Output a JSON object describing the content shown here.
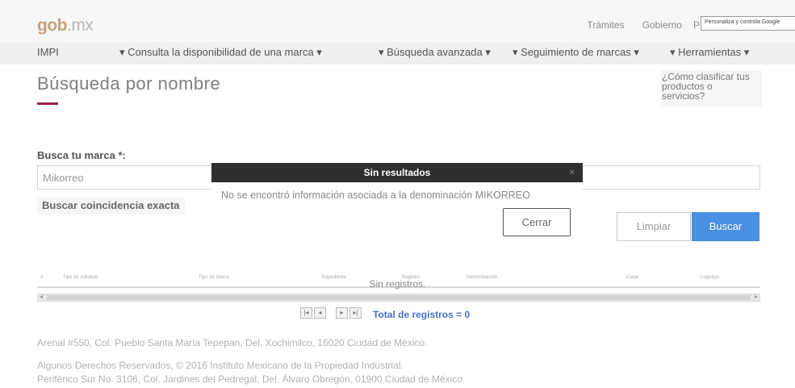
{
  "header": {
    "logo_main": "gob",
    "logo_suffix": ".mx",
    "links": [
      "Trámites",
      "Gobierno"
    ],
    "partial_link": "P",
    "tooltip": "Personaliza y controla Google"
  },
  "nav": {
    "home": "IMPI",
    "items": [
      "Consulta la disponibilidad de una marca",
      "Búsqueda avanzada",
      "Seguimiento de marcas",
      "Herramientas"
    ]
  },
  "page": {
    "title": "Búsqueda por nombre",
    "side_link": "¿Cómo clasificar tus productos o servicios?"
  },
  "form": {
    "label": "Busca tu marca",
    "required_mark": "*:",
    "value": "Mikorreo",
    "exact_match_label": "Buscar coincidencia exacta",
    "clear_label": "Limpiar",
    "search_label": "Buscar"
  },
  "modal": {
    "title": "Sin resultados",
    "close_icon": "×",
    "message": "No se encontró información asociada a la denominación MIKORREO",
    "close_label": "Cerrar"
  },
  "table": {
    "columns": [
      "#",
      "Tipo de solicitud",
      "Tipo de marca",
      "Expediente",
      "Registro",
      "Denominación",
      "Clase",
      "Logotipo"
    ],
    "empty_text": "Sin registros.",
    "total_label": "Total de registros = 0"
  },
  "pager": [
    "|◂",
    "◂",
    "▸",
    "▸|"
  ],
  "footer": {
    "address": "Arenal #550, Col. Pueblo Santa María Tepepan, Del. Xochimilco, 16020 Ciudad de México.",
    "rights": "Algunos Derechos Reservados, © 2016 Instituto Mexicano de la Propiedad Industrial.",
    "address2": "Periférico Sur No. 3106, Col. Jardines del Pedregal, Del. Álvaro Obregón, 01900 Ciudad de México."
  },
  "colors": {
    "accent": "#9d2449",
    "primary_button": "#4a90e2",
    "modal_header": "#2f2f2f",
    "total_text": "#4a6fd1"
  }
}
